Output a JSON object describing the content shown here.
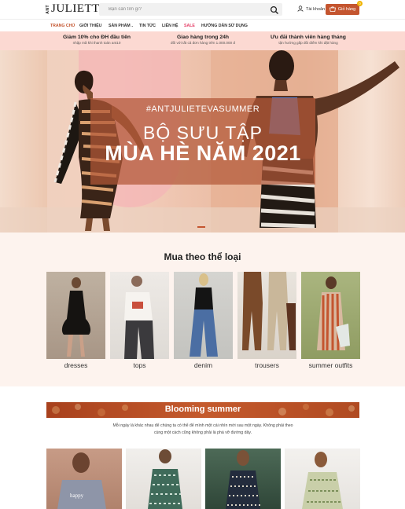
{
  "header": {
    "logo_prefix": "ANT",
    "logo_word": "JULIETTE",
    "search_placeholder": "Bạn cần tìm gì?",
    "account_label": "Tài khoản",
    "cart_label": "Giỏ hàng",
    "cart_count": "0"
  },
  "nav": {
    "items": [
      {
        "label": "Trang chủ"
      },
      {
        "label": "Giới thiệu"
      },
      {
        "label": "Sản phẩm"
      },
      {
        "label": "Tin tức"
      },
      {
        "label": "Liên hệ"
      },
      {
        "label": "Sale"
      },
      {
        "label": "Hướng dẫn sử dụng"
      }
    ]
  },
  "promo": [
    {
      "title": "Giảm 10% cho ĐH đầu tiên",
      "sub": "nhập mã khi thanh toán ant10"
    },
    {
      "title": "Giao hàng trong 24h",
      "sub": "đối với tất cả đơn hàng trên 1.000.000 đ"
    },
    {
      "title": "Ưu đãi thành viên hàng tháng",
      "sub": "tận hưởng gấp đôi điểm khi đặt hàng"
    }
  ],
  "hero": {
    "hashtag": "#ANTJULIETEVASUMMER",
    "title_line1": "BỘ SƯU TẬP",
    "title_line2": "MÙA HÈ NĂM 2021"
  },
  "categories": {
    "title": "Mua theo thể loại",
    "items": [
      {
        "label": "dresses"
      },
      {
        "label": "tops"
      },
      {
        "label": "denim"
      },
      {
        "label": "trousers"
      },
      {
        "label": "summer outfits"
      }
    ]
  },
  "blooming": {
    "title": "Blooming summer",
    "desc_line1": "Mỗi ngày là khác nhau để chúng ta có thể để mình một cái nhìn mới sau một ngày. Không phải theo",
    "desc_line2": "cùng một cách cũng không phải là phá vỡ đường dây."
  },
  "colors": {
    "accent": "#c4552f",
    "promo_bg": "#fcd9d2",
    "section_bg": "#fdf3ee",
    "sale": "#e5426a"
  }
}
